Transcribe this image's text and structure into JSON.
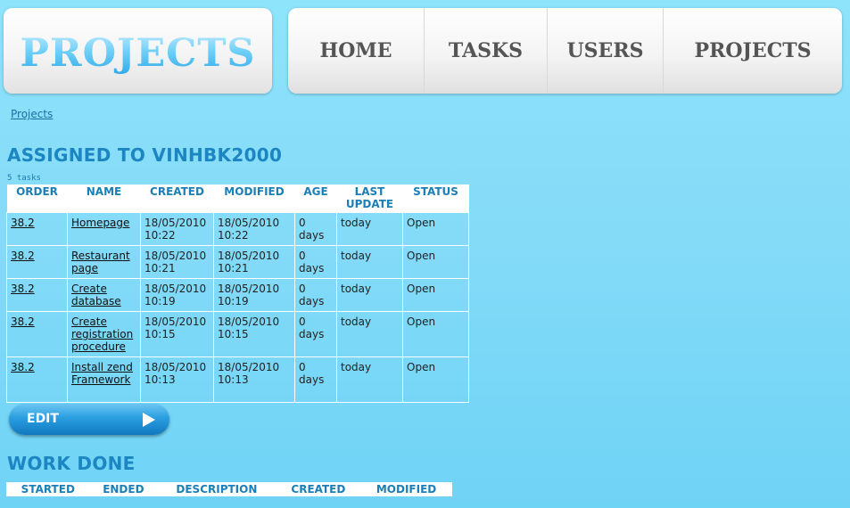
{
  "logo": {
    "text": "PROJECTS"
  },
  "nav": {
    "items": [
      "HOME",
      "TASKS",
      "USERS",
      "PROJECTS"
    ]
  },
  "breadcrumb": "Projects",
  "assigned": {
    "title": "ASSIGNED TO VINHBK2000",
    "count": "5 tasks",
    "columns": [
      "ORDER",
      "NAME",
      "CREATED",
      "MODIFIED",
      "AGE",
      "LAST UPDATE",
      "STATUS"
    ],
    "rows": [
      {
        "order": "38.2",
        "name": "Homepage",
        "created": "18/05/2010 10:22",
        "modified": "18/05/2010 10:22",
        "age": "0 days",
        "last_update": "today",
        "status": "Open"
      },
      {
        "order": "38.2",
        "name": "Restaurant page",
        "created": "18/05/2010 10:21",
        "modified": "18/05/2010 10:21",
        "age": "0 days",
        "last_update": "today",
        "status": "Open"
      },
      {
        "order": "38.2",
        "name": "Create database",
        "created": "18/05/2010 10:19",
        "modified": "18/05/2010 10:19",
        "age": "0 days",
        "last_update": "today",
        "status": "Open"
      },
      {
        "order": "38.2",
        "name": "Create registration procedure",
        "created": "18/05/2010 10:15",
        "modified": "18/05/2010 10:15",
        "age": "0 days",
        "last_update": "today",
        "status": "Open"
      },
      {
        "order": "38.2",
        "name": "Install zend Framework",
        "created": "18/05/2010 10:13",
        "modified": "18/05/2010 10:13",
        "age": "0 days",
        "last_update": "today",
        "status": "Open"
      }
    ]
  },
  "edit_button": {
    "label": "EDIT"
  },
  "work_done": {
    "title": "WORK DONE",
    "columns": [
      "STARTED",
      "ENDED",
      "DESCRIPTION",
      "CREATED",
      "MODIFIED"
    ]
  },
  "colors": {
    "accent": "#1b86c1",
    "background": "#86dcf8",
    "nav_text": "#555555"
  }
}
